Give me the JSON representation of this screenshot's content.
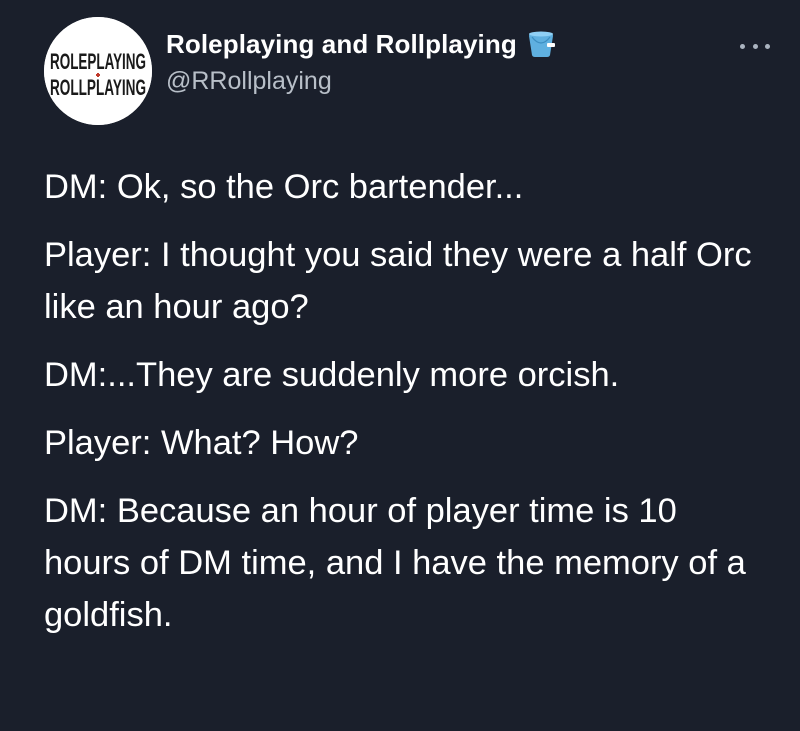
{
  "tweet": {
    "display_name": "Roleplaying and Rollplaying",
    "handle": "@RRollplaying",
    "avatar": {
      "line1": "ROLEPLAYING",
      "line2": "ROLLPLAYING"
    },
    "badge_icon": "bucket-icon",
    "more_icon": "more-options-icon",
    "paragraphs": [
      "DM: Ok, so the Orc bartender...",
      "Player: I thought you said they were a half Orc like an hour ago?",
      "DM:...They are suddenly more orcish.",
      "Player: What? How?",
      "DM: Because an hour of player time is 10 hours of DM time, and I have the memory of a goldfish."
    ]
  },
  "colors": {
    "background": "#1a1f2b",
    "text_primary": "#ffffff",
    "text_secondary": "#b8bfc8",
    "bucket": "#5fb0e0"
  }
}
